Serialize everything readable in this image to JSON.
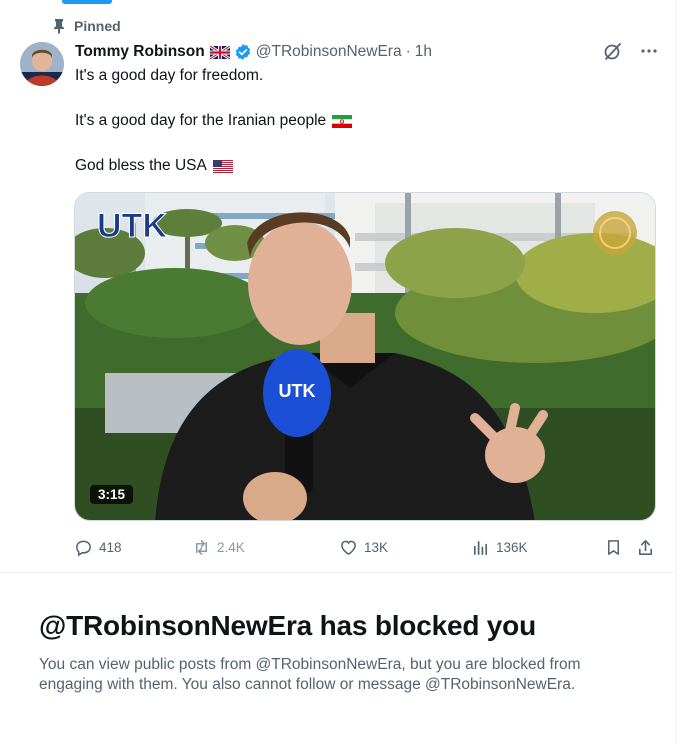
{
  "pinned_label": "Pinned",
  "author": {
    "name": "Tommy Robinson",
    "handle": "@TRobinsonNewEra",
    "separator": "·",
    "time": "1h"
  },
  "tweet": {
    "line1": "It's a good day for freedom.",
    "line2": "It's a good day for the Iranian people",
    "line3": "God bless the USA"
  },
  "media": {
    "duration": "3:15",
    "overlay_logo_left": "UTK",
    "mic_logo": "UTK"
  },
  "stats": {
    "replies": "418",
    "reposts": "2.4K",
    "likes": "13K",
    "views": "136K"
  },
  "blocked": {
    "title": "@TRobinsonNewEra has blocked you",
    "description": "You can view public posts from @TRobinsonNewEra, but you are blocked from engaging with them. You also cannot follow or message @TRobinsonNewEra."
  },
  "colors": {
    "accent": "#1d9bf0",
    "text_primary": "#0f1419",
    "text_secondary": "#536471"
  }
}
